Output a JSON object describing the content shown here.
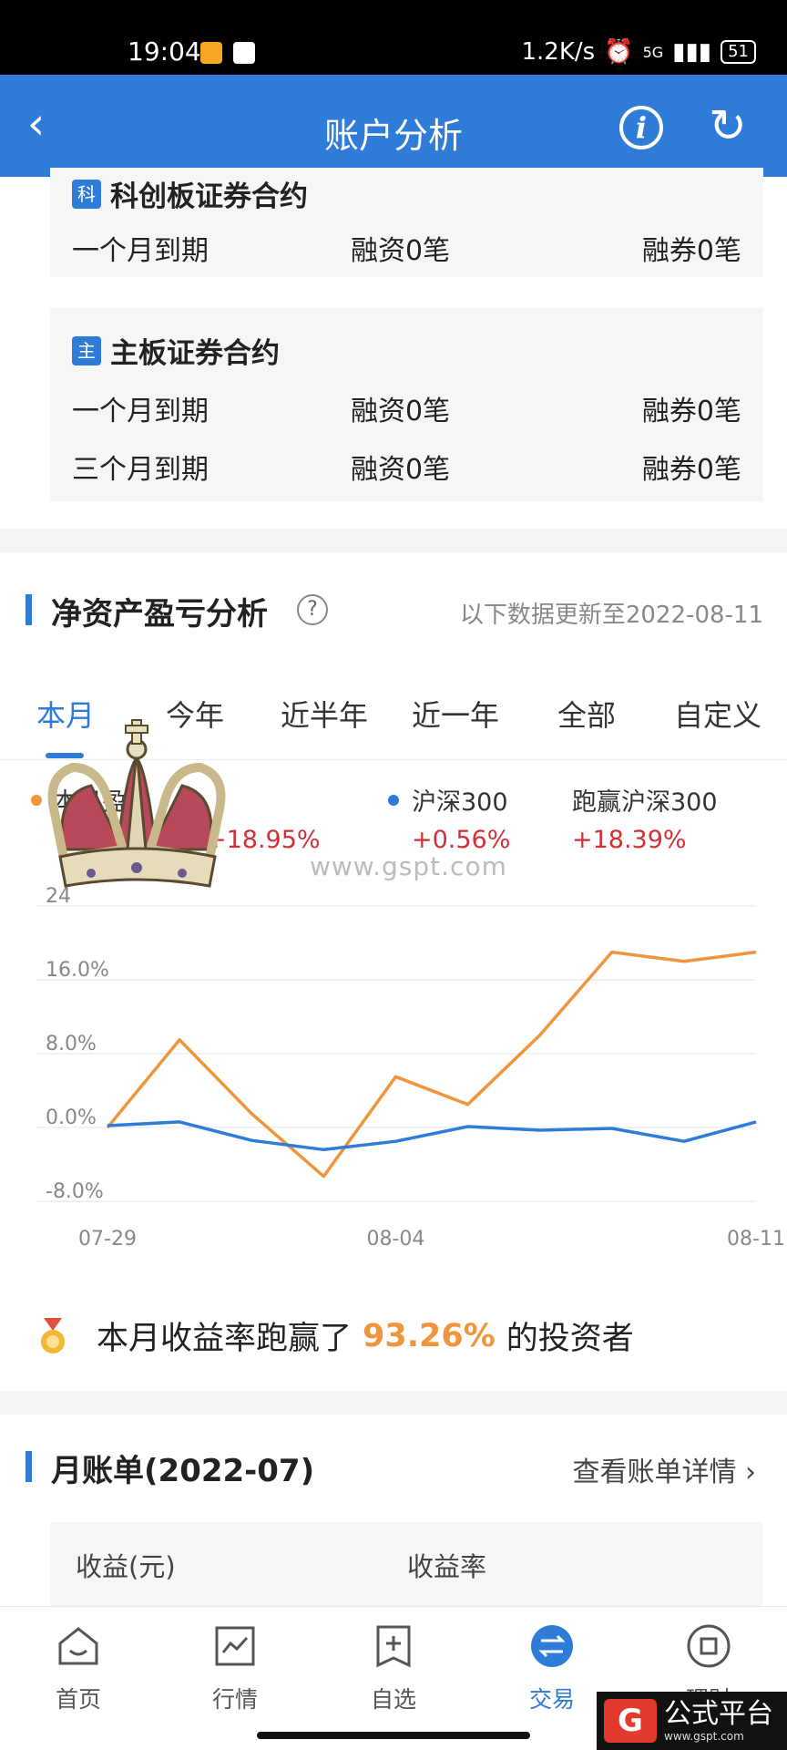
{
  "status_bar": {
    "time": "19:04",
    "net_speed": "1.2K/s",
    "signal": "5G",
    "battery": "51"
  },
  "app_bar": {
    "title": "账户分析",
    "back_icon": "chevron-left-icon",
    "info_icon": "info-icon",
    "refresh_icon": "refresh-icon"
  },
  "contracts": [
    {
      "tag": "科",
      "title": "科创板证券合约",
      "rows": [
        {
          "term": "一个月到期",
          "margin": "融资0笔",
          "short": "融券0笔"
        }
      ]
    },
    {
      "tag": "主",
      "title": "主板证券合约",
      "rows": [
        {
          "term": "一个月到期",
          "margin": "融资0笔",
          "short": "融券0笔"
        },
        {
          "term": "三个月到期",
          "margin": "融资0笔",
          "short": "融券0笔"
        }
      ]
    }
  ],
  "analysis": {
    "title": "净资产盈亏分析",
    "help": "?",
    "update_text": "以下数据更新至2022-08-11",
    "tabs": [
      "本月",
      "今年",
      "近半年",
      "近一年",
      "全部",
      "自定义"
    ],
    "active_tab": 0,
    "legend": [
      {
        "name": "本月盈亏",
        "value": "+18.95%",
        "color": "#f0953c"
      },
      {
        "name": "沪深300",
        "value": "+0.56%",
        "color": "#2f7cd8"
      },
      {
        "name": "跑赢沪深300",
        "value": "+18.39%"
      }
    ],
    "watermark": "www.gspt.com",
    "beat": {
      "prefix": "本月收益率跑赢了",
      "pct": "93.26%",
      "suffix": "的投资者"
    }
  },
  "chart_data": {
    "type": "line",
    "x": [
      "07-29",
      "08-01",
      "08-02",
      "08-03",
      "08-04",
      "08-05",
      "08-08",
      "08-09",
      "08-10",
      "08-11"
    ],
    "x_tick_labels": [
      "07-29",
      "08-04",
      "08-11"
    ],
    "y_tick_labels": [
      "24",
      "16.0%",
      "8.0%",
      "0.0%",
      "-8.0%"
    ],
    "ylim": [
      -8,
      24
    ],
    "grid": true,
    "series": [
      {
        "name": "本月盈亏",
        "color": "#f0953c",
        "values": [
          0,
          9.5,
          1.5,
          -5.3,
          5.5,
          2.5,
          10,
          19,
          18,
          19
        ]
      },
      {
        "name": "沪深300",
        "color": "#2f7cd8",
        "values": [
          0.2,
          0.6,
          -1.4,
          -2.4,
          -1.5,
          0.1,
          -0.3,
          -0.1,
          -1.5,
          0.6
        ]
      }
    ]
  },
  "bill": {
    "title": "月账单(2022-07)",
    "link": "查看账单详情",
    "col1": "收益(元)",
    "col2": "收益率"
  },
  "bottom_nav": [
    {
      "label": "首页",
      "icon": "home-icon"
    },
    {
      "label": "行情",
      "icon": "chart-icon"
    },
    {
      "label": "自选",
      "icon": "add-watchlist-icon"
    },
    {
      "label": "交易",
      "icon": "trade-icon"
    },
    {
      "label": "理财",
      "icon": "wealth-icon"
    }
  ],
  "logo": {
    "mark": "G",
    "name": "公式平台",
    "url": "www.gspt.com"
  }
}
